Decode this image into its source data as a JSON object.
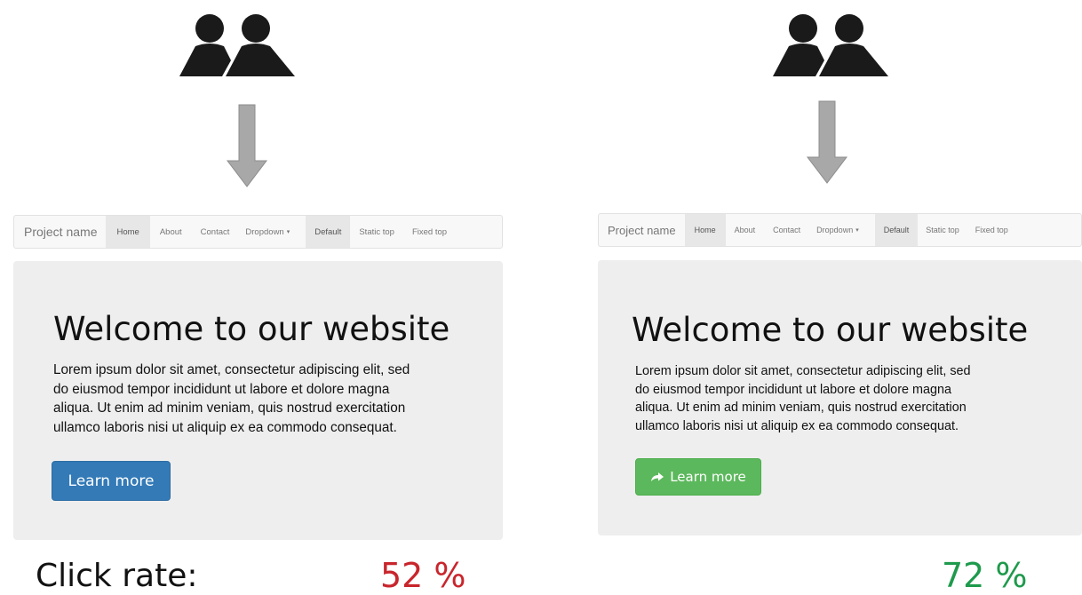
{
  "navbar": {
    "brand": "Project name",
    "items": [
      "Home",
      "About",
      "Contact",
      "Dropdown",
      "Default",
      "Static top",
      "Fixed top"
    ],
    "caret": "▾"
  },
  "jumbotron": {
    "title": "Welcome to our website",
    "text_lines": [
      "Lorem ipsum dolor sit amet, consectetur adipiscing elit, sed",
      "do eiusmod tempor incididunt ut labore et dolore magna",
      "aliqua. Ut enim ad minim veniam, quis nostrud exercitation",
      "ullamco laboris nisi ut aliquip ex ea commodo consequat."
    ],
    "button_label": "Learn more"
  },
  "variant_a": {
    "button_color": "#337ab7",
    "rate": "52 %",
    "rate_color": "#c9252c"
  },
  "variant_b": {
    "button_color": "#5cb85c",
    "button_icon": "arrow-right-icon",
    "rate": "72 %",
    "rate_color": "#1e9a4c"
  },
  "click_rate_label": "Click rate:",
  "icons": {
    "users": "users-icon",
    "arrow": "arrow-down-icon"
  }
}
